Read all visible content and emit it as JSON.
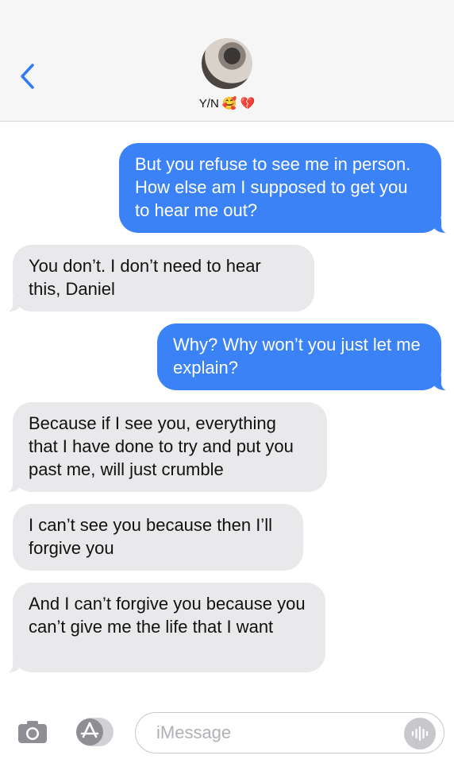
{
  "header": {
    "contact_name": "Y/N",
    "contact_emojis": [
      "🥰",
      "💔"
    ]
  },
  "messages": [
    {
      "direction": "outgoing",
      "text": "But you refuse to see me in person. How else am I supposed to get you to hear me out?"
    },
    {
      "direction": "incoming",
      "text": "You don’t. I don’t need to hear this, Daniel"
    },
    {
      "direction": "outgoing",
      "text": "Why? Why won’t you just let me explain?"
    },
    {
      "direction": "incoming",
      "text": "Because if I see you, everything that I have done to try and put you past me, will just crumble"
    },
    {
      "direction": "incoming",
      "text": "I can’t see you because then I’ll forgive you"
    },
    {
      "direction": "incoming",
      "text": "And I can’t forgive you because you can’t give me the life that I want"
    }
  ],
  "input": {
    "placeholder": "iMessage"
  },
  "icons": {
    "back": "chevron-left-icon",
    "camera": "camera-icon",
    "apps": "app-store-icon",
    "voice": "audio-waveform-icon"
  },
  "colors": {
    "accent": "#3b82f6",
    "incoming_bubble": "#e9e9eb",
    "header_bg": "#f6f6f6"
  }
}
